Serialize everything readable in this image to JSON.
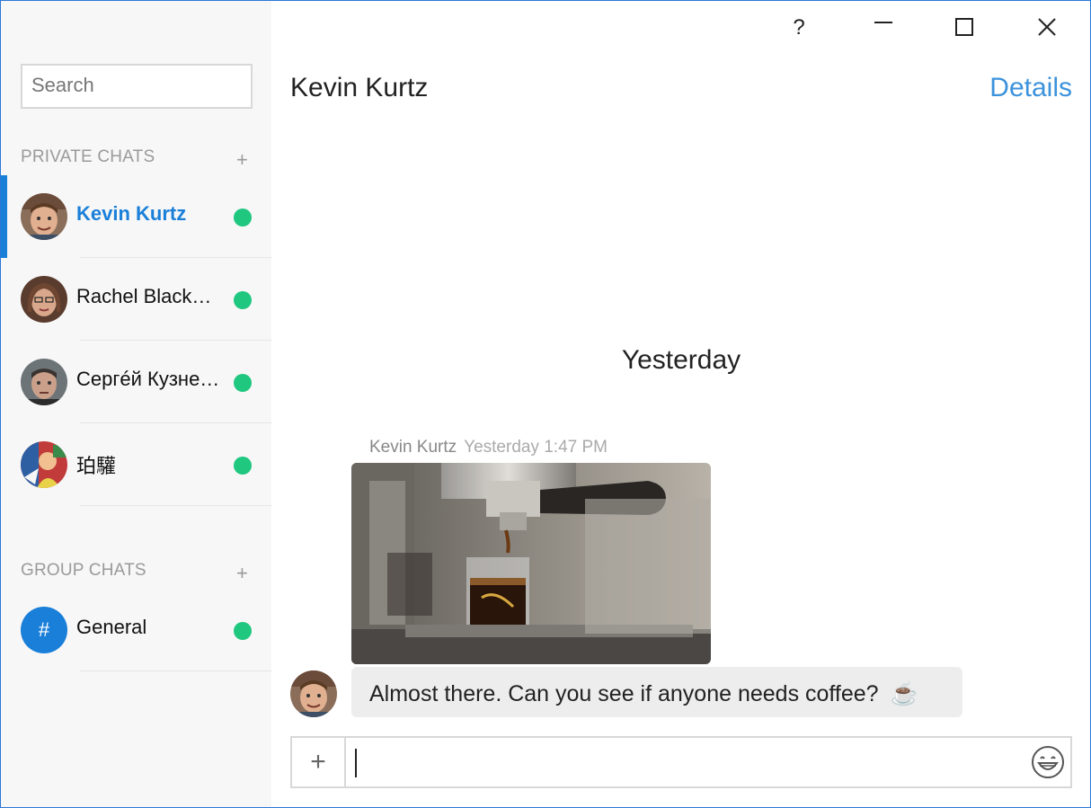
{
  "window_controls": {
    "help": "?",
    "minimize": "—",
    "maximize": "☐",
    "close": "✕"
  },
  "sidebar": {
    "search": {
      "placeholder": "Search",
      "value": ""
    },
    "private_header": "PRIVATE CHATS",
    "group_header": "GROUP CHATS",
    "add_label": "+",
    "private_chats": [
      {
        "name": "Kevin Kurtz",
        "status": "online",
        "active": true
      },
      {
        "name": "Rachel Black…",
        "status": "online",
        "active": false
      },
      {
        "name": "Сергéй Кузне…",
        "status": "online",
        "active": false
      },
      {
        "name": "珀驩",
        "status": "online",
        "active": false
      }
    ],
    "group_chats": [
      {
        "name": "General",
        "icon": "#",
        "status": "online"
      }
    ]
  },
  "conversation": {
    "title": "Kevin Kurtz",
    "details_label": "Details",
    "date_separator": "Yesterday",
    "messages": [
      {
        "author": "Kevin Kurtz",
        "time": "Yesterday 1:47 PM",
        "image": "espresso-machine-photo",
        "text": "Almost there.  Can you see if anyone needs coffee?",
        "emoji": "☕"
      }
    ]
  },
  "composer": {
    "attach_label": "+",
    "value": "",
    "emoji_icon": "smiley-icon"
  },
  "colors": {
    "accent": "#1a7fd9",
    "presence": "#1fc77f",
    "window_border": "#2b79d6"
  }
}
